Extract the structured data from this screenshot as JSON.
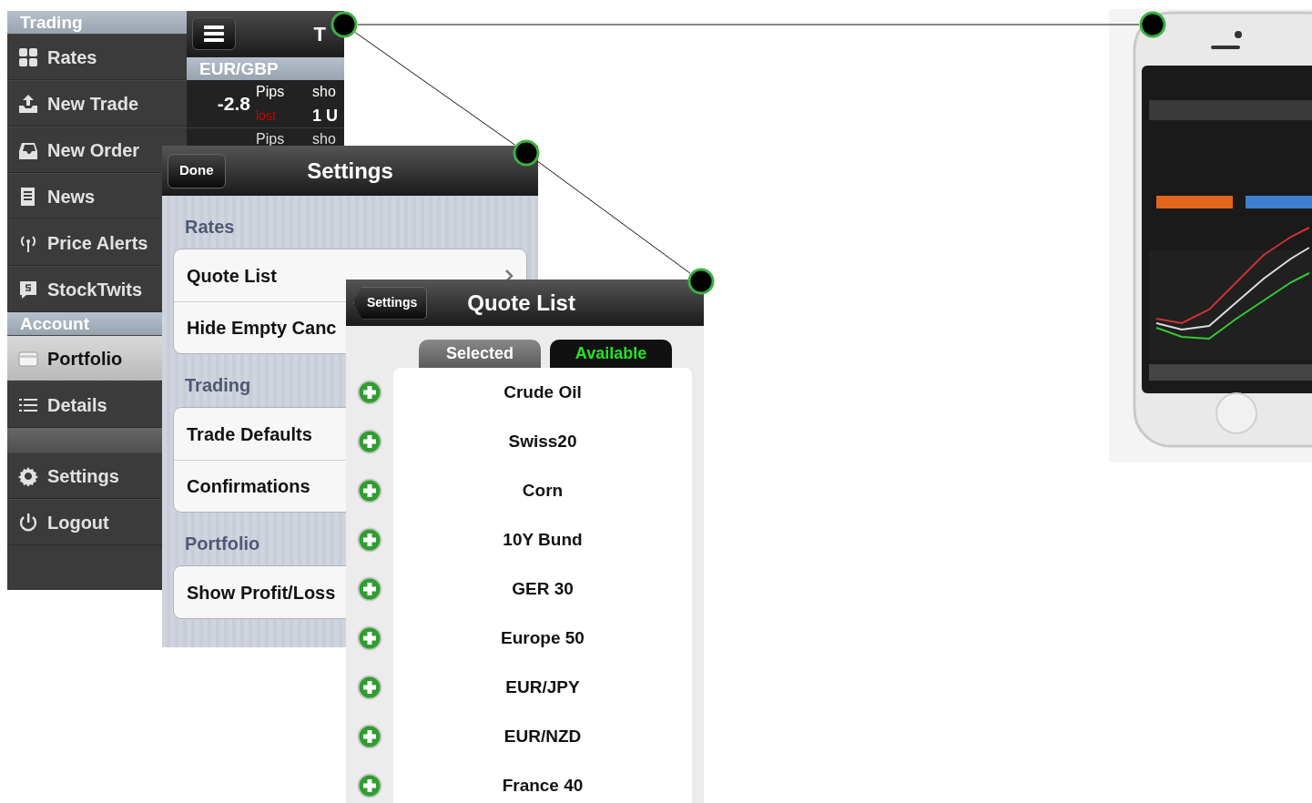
{
  "menu_app": {
    "sections": [
      {
        "title": "Trading",
        "items": [
          {
            "label": "Rates",
            "selected": false
          },
          {
            "label": "New Trade",
            "selected": false
          },
          {
            "label": "New Order",
            "selected": false
          },
          {
            "label": "News",
            "selected": false
          },
          {
            "label": "Price Alerts",
            "selected": false
          },
          {
            "label": "StockTwits",
            "selected": false
          }
        ]
      },
      {
        "title": "Account",
        "items": [
          {
            "label": "Portfolio",
            "selected": true
          },
          {
            "label": "Details",
            "selected": false
          }
        ]
      },
      {
        "items": [
          {
            "label": "Settings",
            "selected": false
          },
          {
            "label": "Logout",
            "selected": false
          }
        ]
      }
    ],
    "top_bar": {
      "title": "T"
    },
    "quote": {
      "pair": "EUR/GBP",
      "rows": [
        {
          "value": "-2.8",
          "unit": "Pips",
          "status": "lost",
          "side": "sho",
          "amount": "1 U"
        },
        {
          "unit": "Pips",
          "side": "sho"
        }
      ]
    }
  },
  "settings": {
    "nav": {
      "button": "Done",
      "title": "Settings"
    },
    "sections": [
      {
        "title": "Rates",
        "rows": [
          {
            "label": "Quote List",
            "kind": "disclosure"
          },
          {
            "label": "Hide Empty Canc",
            "kind": "plain"
          }
        ]
      },
      {
        "title": "Trading",
        "rows": [
          {
            "label": "Trade Defaults",
            "kind": "plain"
          },
          {
            "label": "Confirmations",
            "kind": "plain"
          }
        ]
      },
      {
        "title": "Portfolio",
        "rows": [
          {
            "label": "Show Profit/Loss",
            "kind": "plain"
          }
        ]
      }
    ]
  },
  "quote_list": {
    "nav": {
      "back": "Settings",
      "title": "Quote List"
    },
    "tabs": [
      {
        "label": "Selected",
        "selected": false
      },
      {
        "label": "Available",
        "selected": true
      }
    ],
    "items": [
      "Crude Oil",
      "Swiss20",
      "Corn",
      "10Y Bund",
      "GER 30",
      "Europe 50",
      "EUR/JPY",
      "EUR/NZD",
      "France 40"
    ]
  }
}
